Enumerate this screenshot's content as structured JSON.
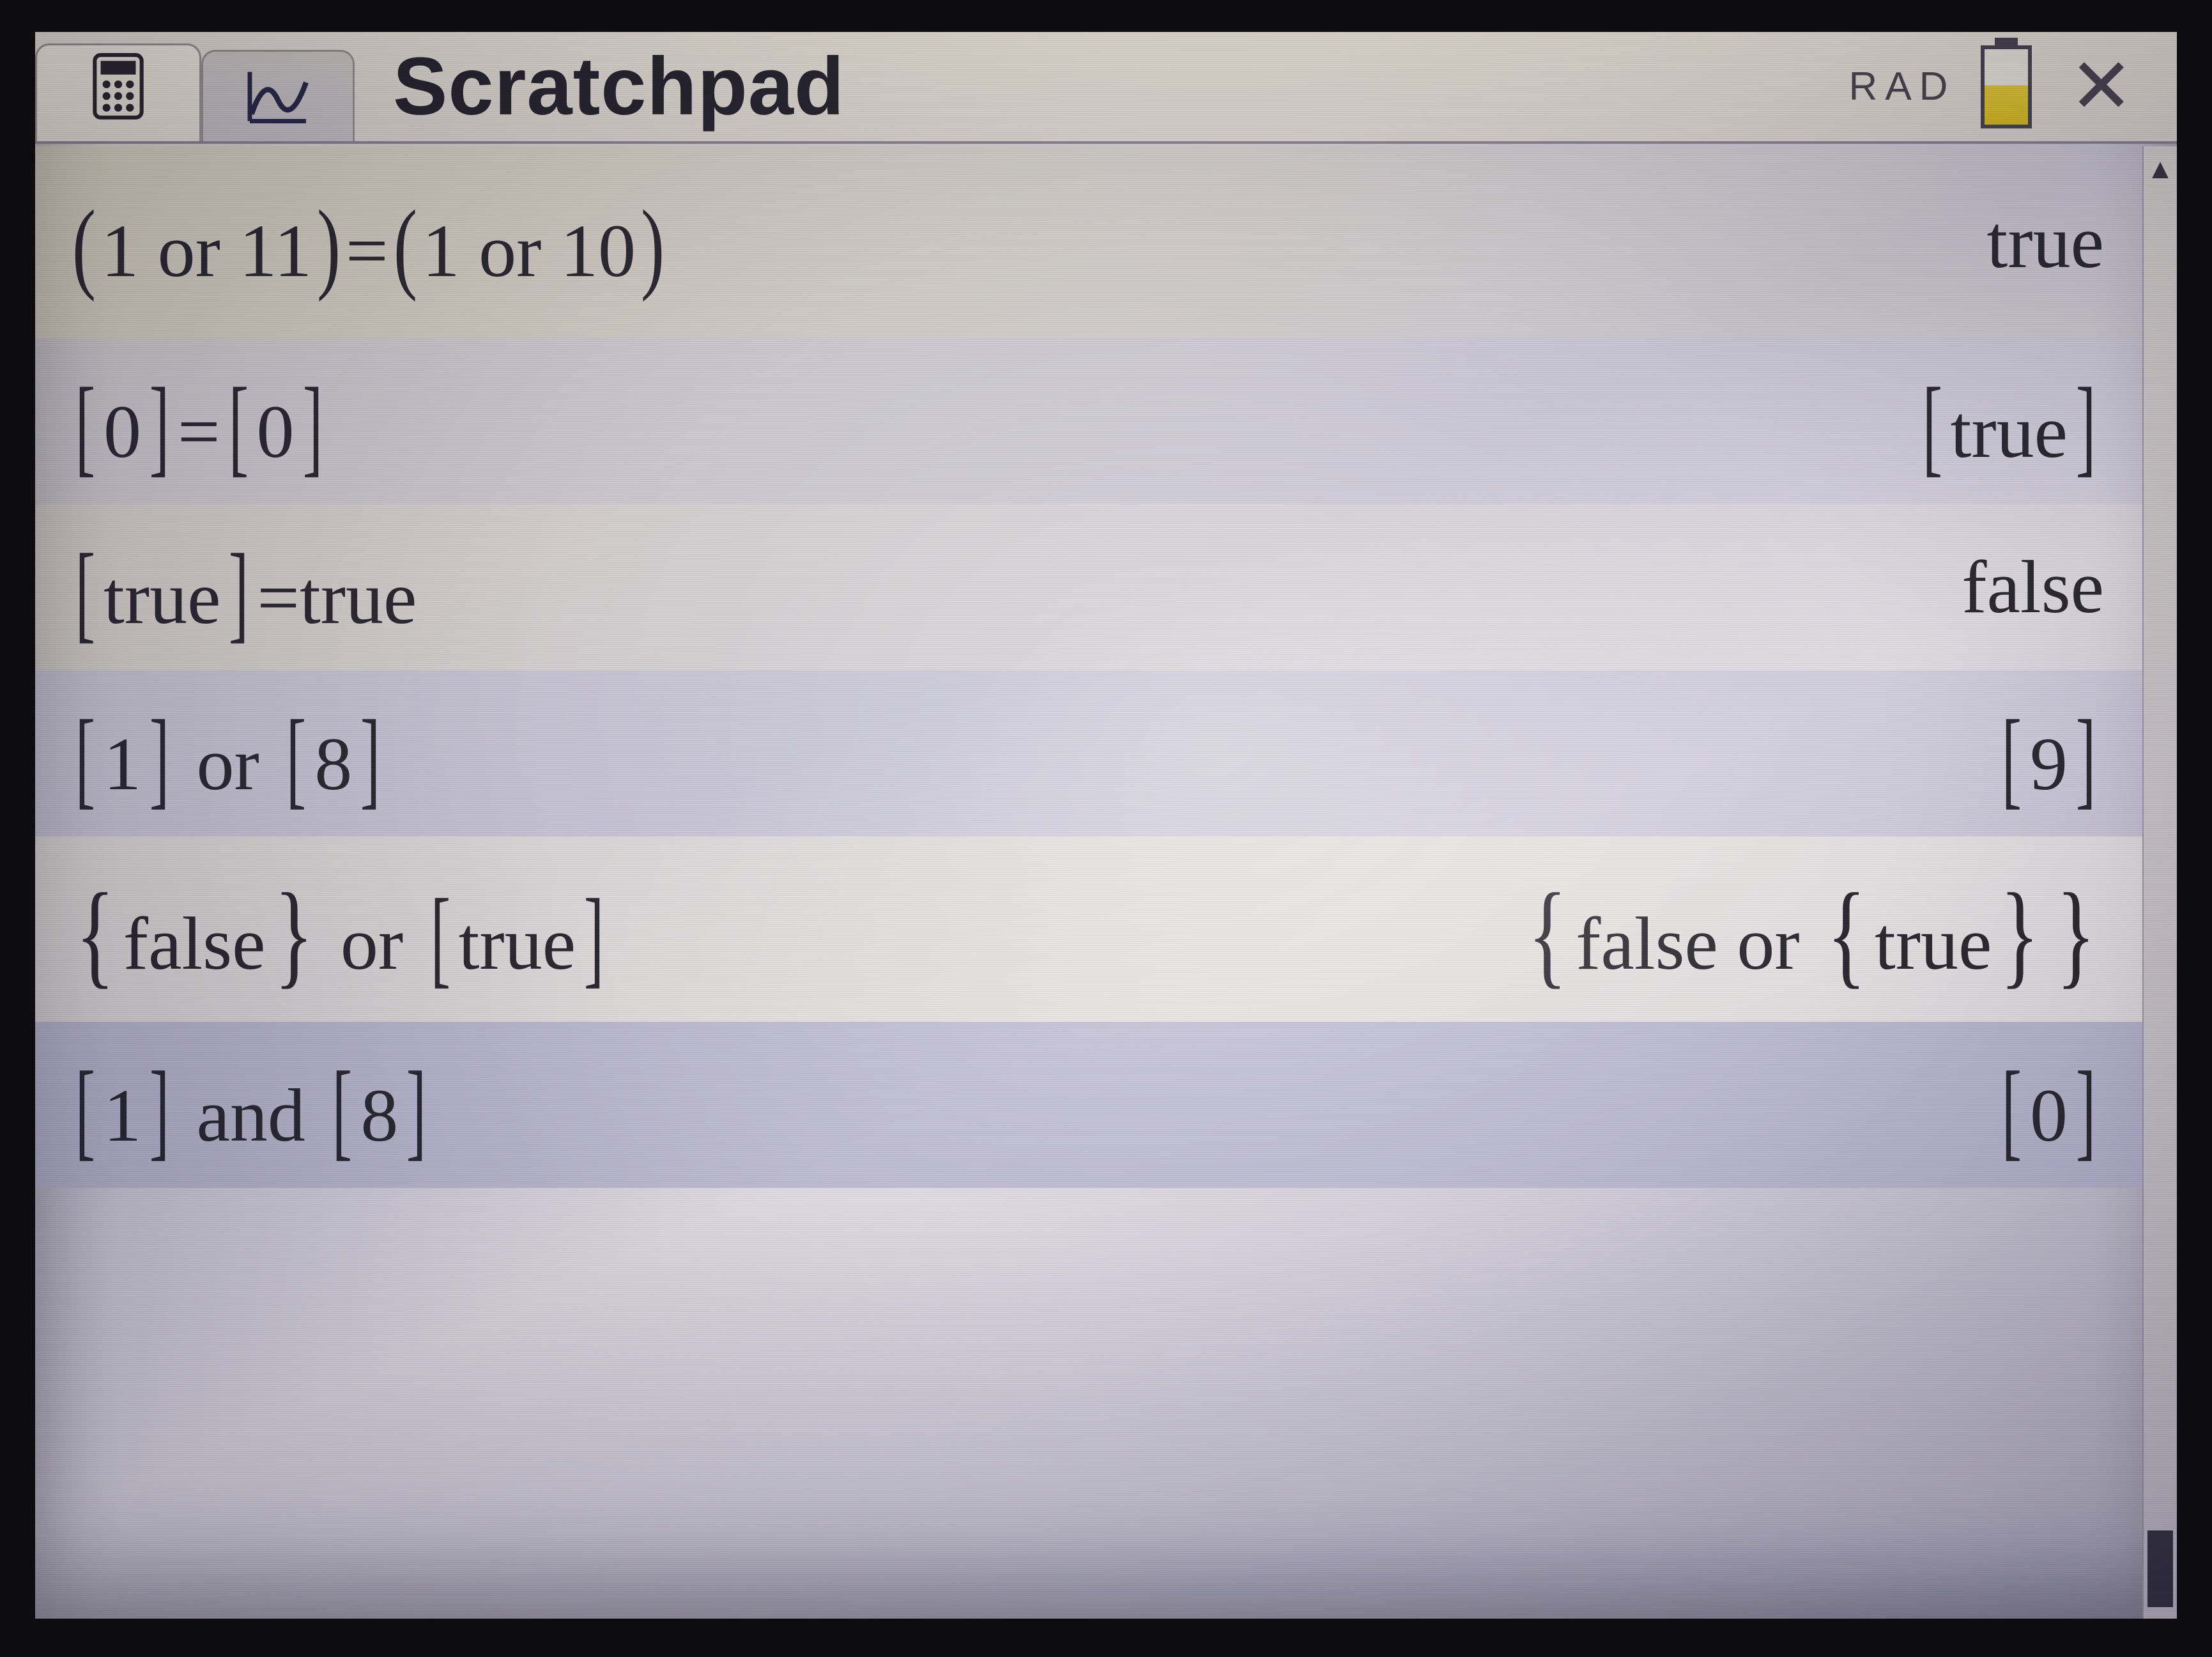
{
  "toolbar": {
    "title": "Scratchpad",
    "angle_mode": "RAD",
    "close_label": "✕",
    "tabs": {
      "calculator_icon": "🖩",
      "graph_icon": "graph"
    }
  },
  "battery": {
    "level_percent": 50,
    "fill_color": "#e2c838"
  },
  "history": [
    {
      "input": "(1 or 11)=(1 or 10)",
      "output": "true"
    },
    {
      "input": "[0]=[0]",
      "output": "[true]"
    },
    {
      "input": "[true]=true",
      "output": "false"
    },
    {
      "input": "[1] or [8]",
      "output": "[9]"
    },
    {
      "input": "{false} or [true]",
      "output": "{false or {true}}"
    },
    {
      "input": "[1] and [8]",
      "output": "[0]"
    }
  ],
  "scroll": {
    "up_glyph": "▲"
  }
}
